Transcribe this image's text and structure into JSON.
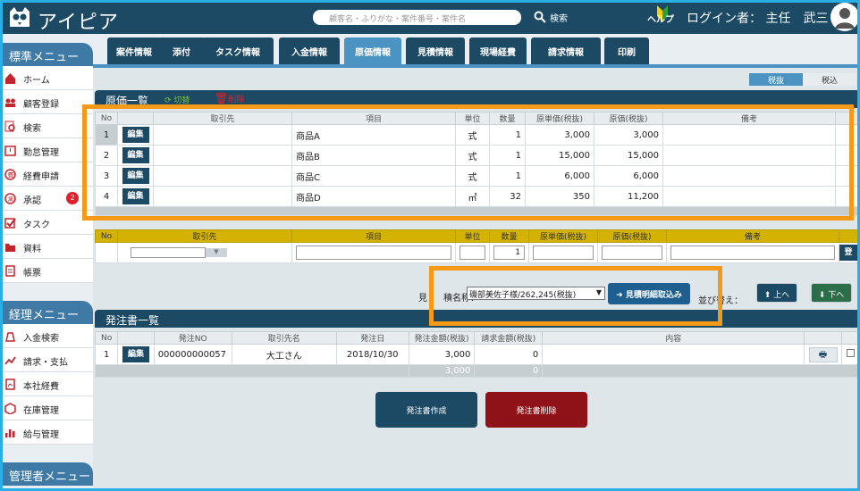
{
  "header": {
    "brand": "アイピア",
    "search_placeholder": "顧客名・ふりがな・案件番号・案件名",
    "search_button": "検索",
    "help": "ヘルプ",
    "login": "ログイン者： 主任　武三"
  },
  "sidebar": {
    "std_title": "標準メニュー",
    "std_items": [
      {
        "label": "ホーム",
        "icon": "home-icon"
      },
      {
        "label": "顧客登録",
        "icon": "users-icon"
      },
      {
        "label": "検索",
        "icon": "search-doc-icon"
      },
      {
        "label": "勤怠管理",
        "icon": "clock-icon"
      },
      {
        "label": "経費申請",
        "icon": "expense-icon"
      },
      {
        "label": "承認",
        "icon": "approve-icon",
        "badge": "2"
      },
      {
        "label": "タスク",
        "icon": "checkbox-icon"
      },
      {
        "label": "資料",
        "icon": "folder-icon"
      },
      {
        "label": "帳票",
        "icon": "document-icon"
      }
    ],
    "acct_title": "経理メニュー",
    "acct_items": [
      {
        "label": "入金検索",
        "icon": "money-bag-icon"
      },
      {
        "label": "請求・支払",
        "icon": "payment-icon"
      },
      {
        "label": "本社経費",
        "icon": "ledger-icon"
      },
      {
        "label": "在庫管理",
        "icon": "box-icon"
      },
      {
        "label": "給与管理",
        "icon": "bar-chart-icon"
      }
    ],
    "admin_title": "管理者メニュー"
  },
  "tabs": [
    "案件情報",
    "添付",
    "タスク情報",
    "入金情報",
    "原価情報",
    "見積情報",
    "現場経費",
    "請求情報",
    "印刷"
  ],
  "active_tab": "原価情報",
  "tax": {
    "excl": "税抜",
    "incl": "税込"
  },
  "cost": {
    "title": "原価一覧",
    "switch_label": "切替",
    "delete_label": "削除",
    "headers": [
      "No",
      "",
      "取引先",
      "項目",
      "単位",
      "数量",
      "原単価(税抜)",
      "原価(税抜)",
      "備考"
    ],
    "edit_label": "編集",
    "rows": [
      [
        "1",
        "",
        "商品A",
        "式",
        "1",
        "3,000",
        "3,000",
        ""
      ],
      [
        "2",
        "",
        "商品B",
        "式",
        "1",
        "15,000",
        "15,000",
        ""
      ],
      [
        "3",
        "",
        "商品C",
        "式",
        "1",
        "6,000",
        "6,000",
        ""
      ],
      [
        "4",
        "",
        "商品D",
        "㎡",
        "32",
        "350",
        "11,200",
        ""
      ]
    ]
  },
  "entry": {
    "headers": [
      "No",
      "取引先",
      "項目",
      "単位",
      "数量",
      "原単価(税抜)",
      "原価(税抜)",
      "備考"
    ],
    "qty": "1",
    "register_label": "登"
  },
  "estimate": {
    "label_prefix": "見",
    "label_suffix": "積名称：",
    "selected": "磯部美佐子様/262,245(税抜)",
    "import_label": "見積明細取込み",
    "sort_prefix": "並",
    "sort_suffix": "び替え：",
    "up": "上へ",
    "down": "下へ"
  },
  "order": {
    "title": "発注書一覧",
    "headers": [
      "No",
      "",
      "発注NO",
      "取引先名",
      "発注日",
      "発注金額(税抜)",
      "請求金額(税抜)",
      "内容",
      "",
      ""
    ],
    "rows": [
      {
        "no": "1",
        "edit": "編集",
        "order_no": "000000000057",
        "vendor": "大工さん",
        "date": "2018/10/30",
        "amount": "3,000",
        "billed": "0",
        "content": ""
      }
    ],
    "total_amount": "3,000",
    "total_billed": "0",
    "create_label": "発注書作成",
    "delete_label": "発注書削除"
  },
  "colors": {
    "navy": "#1c4964",
    "blue": "#4a93c2",
    "gold": "#d4b300",
    "red": "#8e1218",
    "orange": "#f59a17"
  }
}
